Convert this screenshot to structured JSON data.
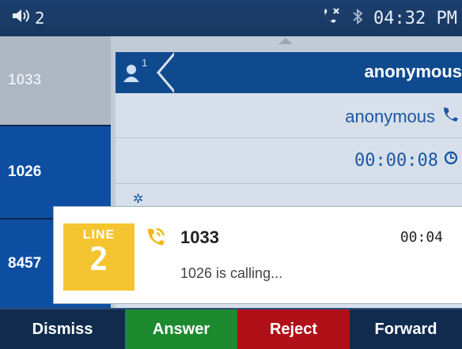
{
  "status": {
    "volume_level": "2",
    "time": "04:32 PM",
    "icons": [
      "volume-icon",
      "missed-call-icon",
      "bluetooth-icon"
    ]
  },
  "lines": [
    {
      "label": "1033",
      "state": "dim"
    },
    {
      "label": "1026",
      "state": "active"
    },
    {
      "label": "8457",
      "state": "other"
    }
  ],
  "call": {
    "header_name": "anonymous",
    "header_badge_count": "1",
    "caller_name": "anonymous",
    "duration": "00:00:08"
  },
  "popup": {
    "line_label": "LINE",
    "line_number": "2",
    "caller": "1033",
    "time": "00:04",
    "message": "1026 is calling..."
  },
  "softkeys": {
    "dismiss": "Dismiss",
    "answer": "Answer",
    "reject": "Reject",
    "forward": "Forward"
  },
  "colors": {
    "answer": "#1e8a2f",
    "reject": "#b01018",
    "line_badge": "#f5c531",
    "active_line": "#0d4ea1"
  }
}
